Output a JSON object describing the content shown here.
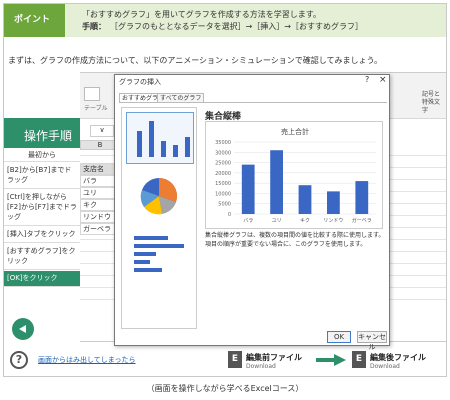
{
  "header": {
    "badge": "ポイント",
    "line1": "「おすすめグラフ」を用いてグラフを作成する方法を学習します。",
    "line2_label": "手順：",
    "line2": "［グラフのもととなるデータを選択］→［挿入］→［おすすめグラフ］"
  },
  "intro": "まずは、グラフの作成方法について、以下のアニメーション・シミュレーションで確認してみましょう。",
  "left_panel": {
    "title": "操作手順",
    "subtitle": "最初から",
    "steps": [
      "[B2]から[B7]までドラッグ",
      "[Ctrl]を押しながら[F2]から[F7]までドラッグ",
      "[挿入]タブをクリック",
      "[おすすめグラフ]をクリック",
      "[OK]をクリック"
    ]
  },
  "ribbon": {
    "tab_fragment": "テーブル",
    "right_fragment": "記号と特殊文字"
  },
  "sheet": {
    "col_header": "B",
    "rows": [
      "支店名",
      "バラ",
      "ユリ",
      "キク",
      "リンドウ",
      "ガーベラ"
    ]
  },
  "dialog": {
    "title": "グラフの挿入",
    "help": "?",
    "close": "×",
    "tabs": [
      "おすすめグラフ",
      "すべてのグラフ"
    ],
    "chart_title": "集合縦棒",
    "description": "集合縦棒グラフは、複数の項目間の値を比較する際に使用します。項目の順序が重要でない場合に、このグラフを使用します。",
    "ok": "OK",
    "cancel": "キャンセル"
  },
  "chart_data": {
    "type": "bar",
    "title": "売上合計",
    "categories": [
      "バラ",
      "ユリ",
      "キク",
      "リンドウ",
      "ガーベラ"
    ],
    "values": [
      24000,
      31000,
      14000,
      11000,
      16000
    ],
    "yticks": [
      0,
      5000,
      10000,
      15000,
      20000,
      25000,
      30000,
      35000
    ],
    "ylim": [
      0,
      35000
    ],
    "xlabel": "",
    "ylabel": "",
    "grid": true
  },
  "footer": {
    "question": "?",
    "link": "画面からはみ出してしまったら",
    "before_title": "編集前ファイル",
    "before_sub": "Download",
    "after_title": "編集後ファイル",
    "after_sub": "Download",
    "file_letter": "E"
  },
  "caption": "（画面を操作しながら学べるExcelコース）",
  "colors": {
    "accent": "#2e8f6b",
    "header_green": "#6da63a",
    "bar": "#3a66c4"
  }
}
